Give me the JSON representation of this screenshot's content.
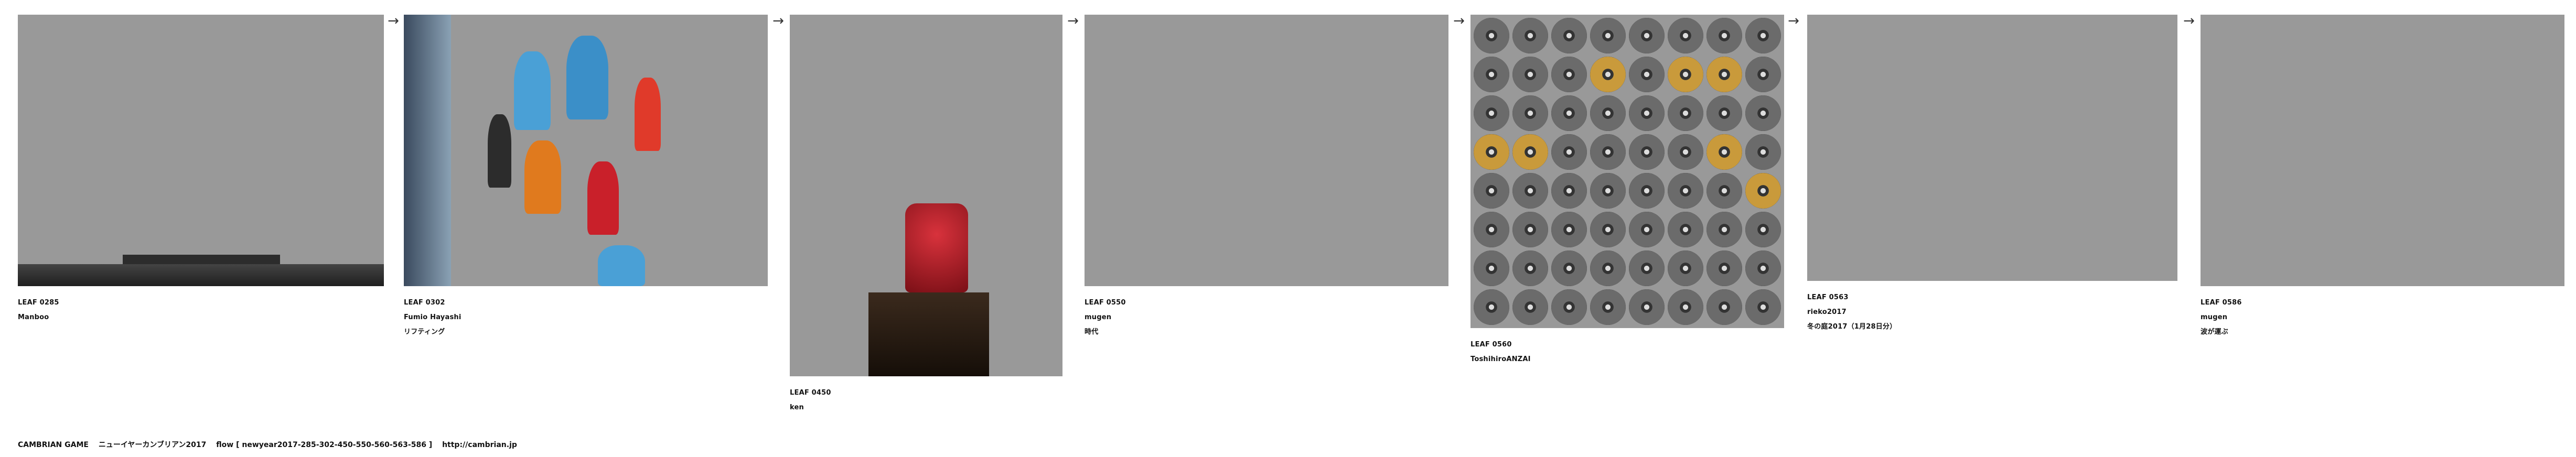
{
  "leaves": [
    {
      "id": "LEAF 0285",
      "author": "Manboo",
      "title": ""
    },
    {
      "id": "LEAF 0302",
      "author": "Fumio Hayashi",
      "title": "リフティング"
    },
    {
      "id": "LEAF 0450",
      "author": "ken",
      "title": ""
    },
    {
      "id": "LEAF 0550",
      "author": "mugen",
      "title": "時代"
    },
    {
      "id": "LEAF 0560",
      "author": "ToshihiroANZAI",
      "title": ""
    },
    {
      "id": "LEAF 0563",
      "author": "rieko2017",
      "title": "冬の庭2017（1月28日分）"
    },
    {
      "id": "LEAF 0586",
      "author": "mugen",
      "title": "波が運ぶ"
    }
  ],
  "arrow": "→",
  "footer": {
    "game": "CAMBRIAN GAME",
    "event": "ニューイヤーカンブリアン2017",
    "flow": "flow [ newyear2017-285-302-450-550-560-563-586 ]",
    "url": "http://cambrian.jp"
  }
}
